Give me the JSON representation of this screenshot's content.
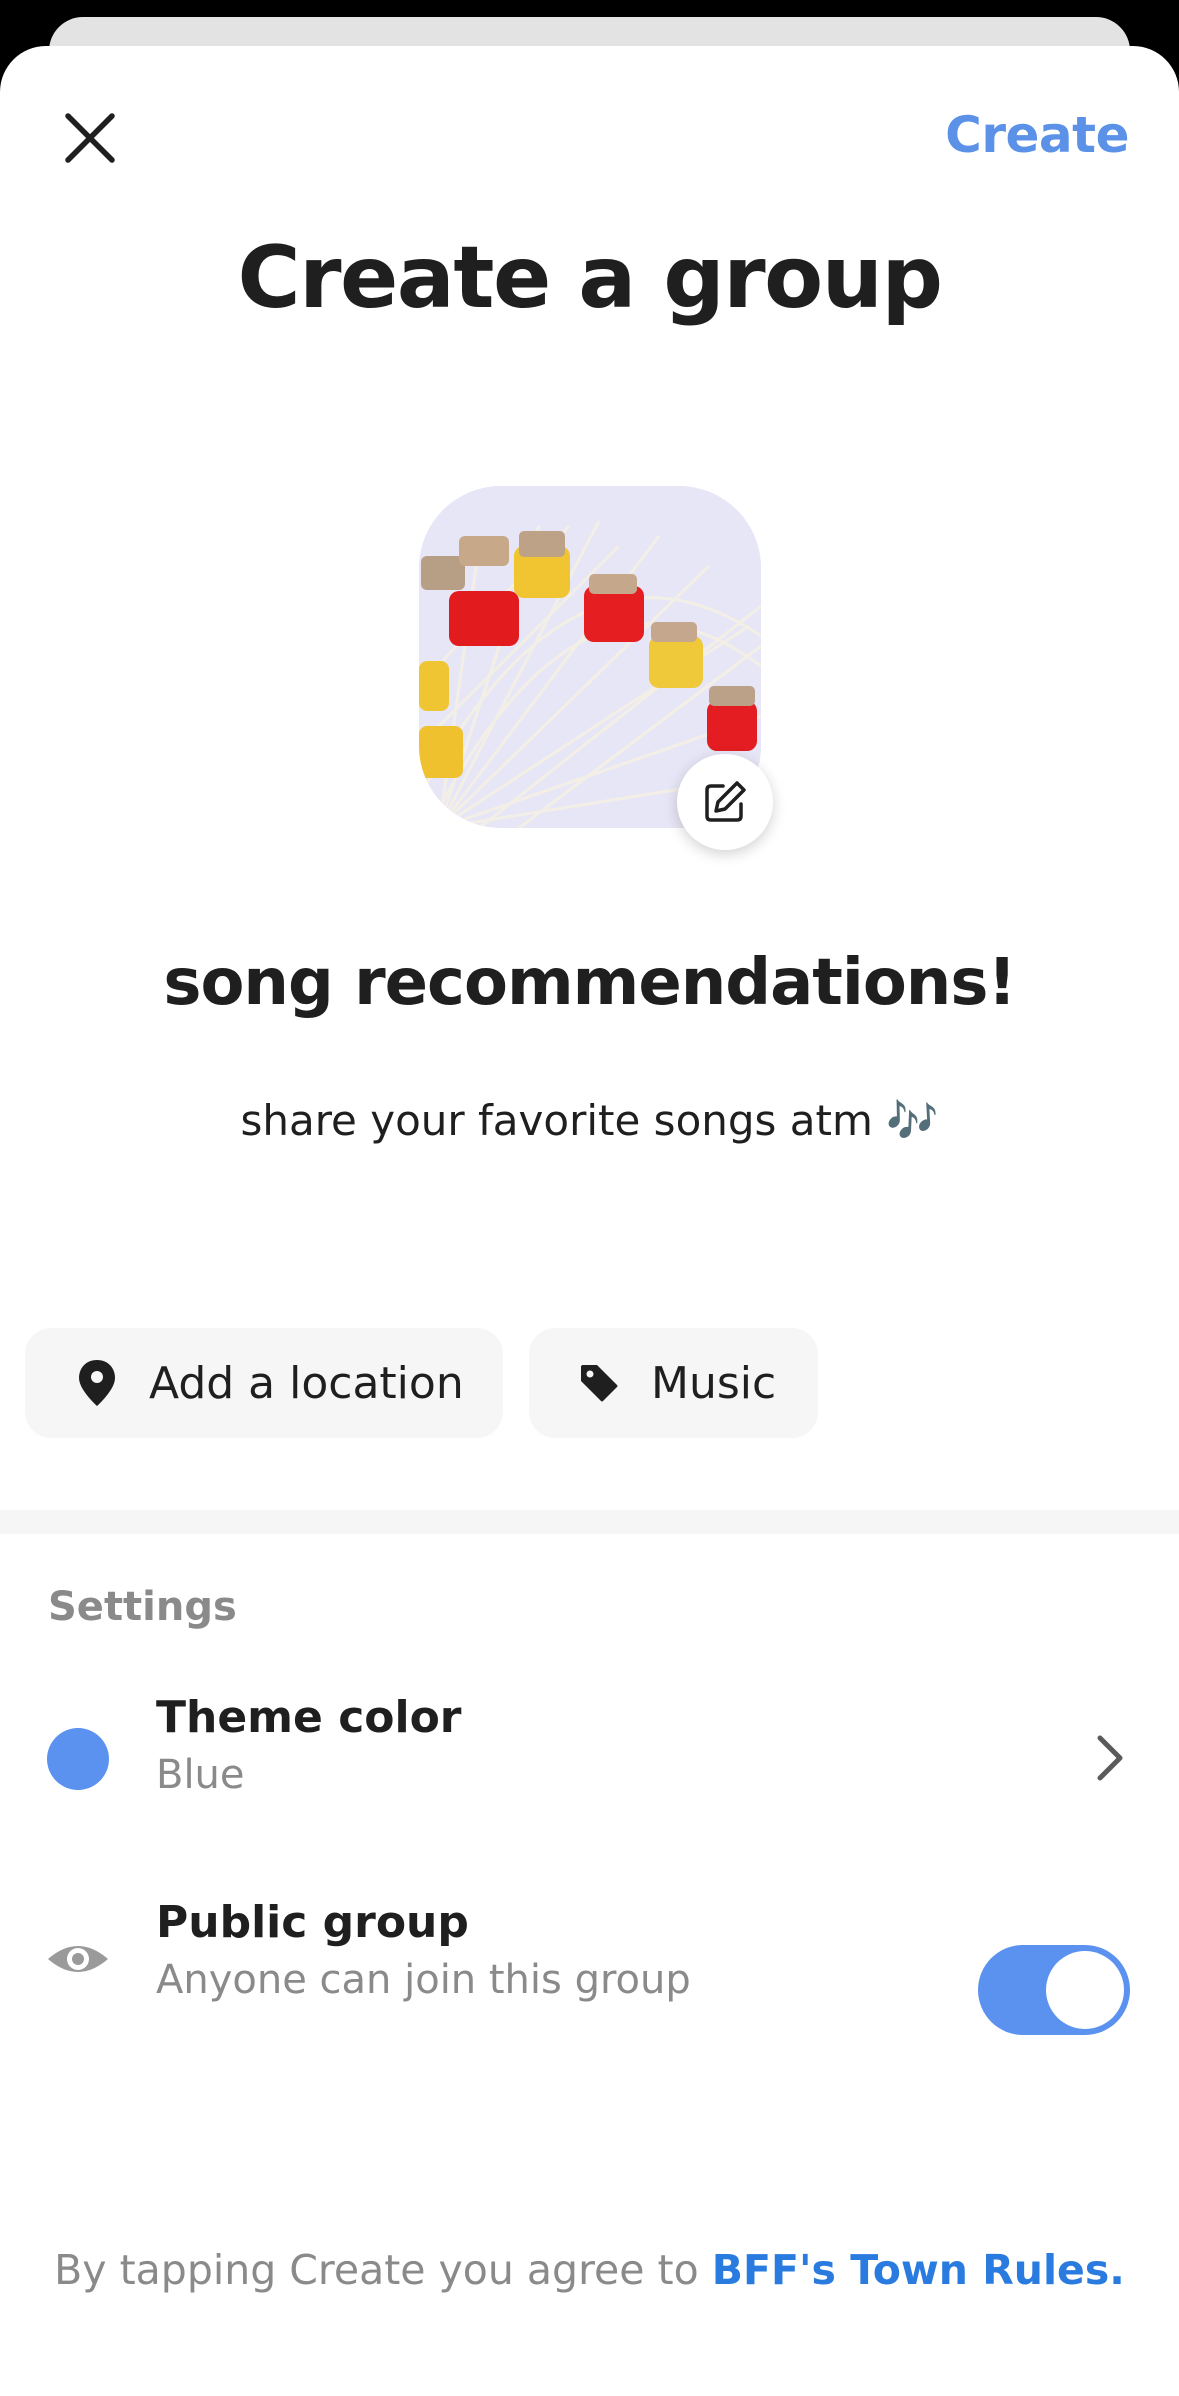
{
  "header": {
    "create_label": "Create",
    "title": "Create a group"
  },
  "group": {
    "name": "song recommendations!",
    "description": "share your favorite songs atm 🎶"
  },
  "chips": {
    "location_label": "Add a location",
    "category_label": "Music"
  },
  "settings": {
    "heading": "Settings",
    "theme": {
      "title": "Theme color",
      "value": "Blue",
      "color": "#5b92f0"
    },
    "public": {
      "title": "Public group",
      "subtitle": "Anyone can join this group",
      "enabled": true
    }
  },
  "footer": {
    "text": "By tapping Create you agree to ",
    "link": "BFF's Town Rules."
  },
  "icons": {
    "close": "close-icon",
    "edit": "edit-icon",
    "location": "location-pin-icon",
    "tag": "tag-icon",
    "chevron": "chevron-right-icon",
    "eye": "eye-icon"
  },
  "colors": {
    "accent": "#5b92e8",
    "link": "#2a7be0"
  }
}
